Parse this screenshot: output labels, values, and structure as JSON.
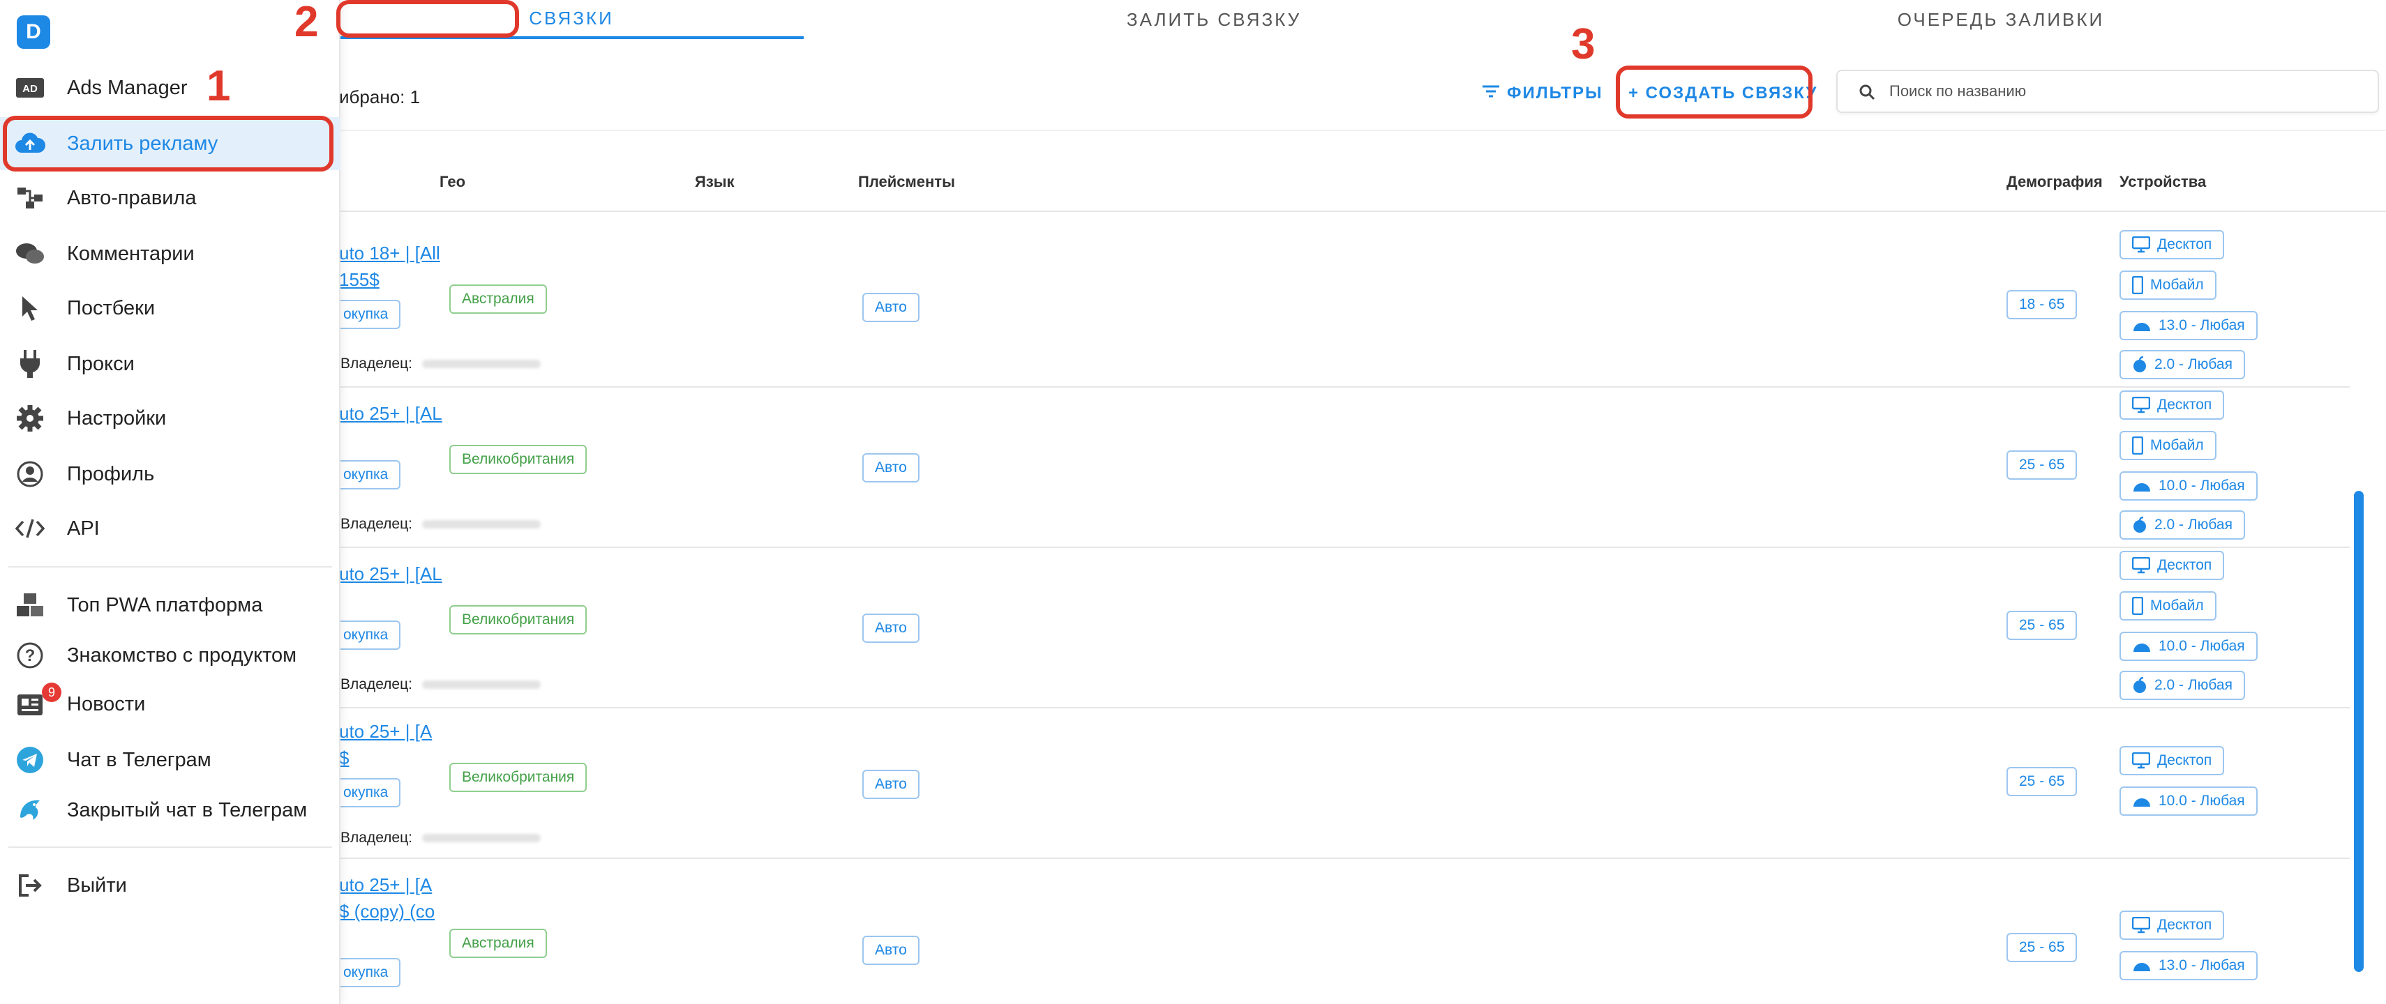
{
  "sidebar": {
    "logo": "D",
    "items": [
      {
        "label": "Ads Manager",
        "icon": "ad-icon"
      },
      {
        "label": "Залить рекламу",
        "icon": "cloud-upload-icon"
      },
      {
        "label": "Авто-правила",
        "icon": "rules-icon"
      },
      {
        "label": "Комментарии",
        "icon": "comments-icon"
      },
      {
        "label": "Постбеки",
        "icon": "cursor-icon"
      },
      {
        "label": "Прокси",
        "icon": "plug-icon"
      },
      {
        "label": "Настройки",
        "icon": "gear-icon"
      },
      {
        "label": "Профиль",
        "icon": "profile-icon"
      },
      {
        "label": "API",
        "icon": "code-icon"
      },
      {
        "label": "Топ PWA платформа",
        "icon": "boxes-icon"
      },
      {
        "label": "Знакомство с продуктом",
        "icon": "help-icon"
      },
      {
        "label": "Новости",
        "icon": "news-icon",
        "badge": "9"
      },
      {
        "label": "Чат в Телеграм",
        "icon": "telegram-icon"
      },
      {
        "label": "Закрытый чат в Телеграм",
        "icon": "dolphin-icon"
      },
      {
        "label": "Выйти",
        "icon": "logout-icon"
      }
    ]
  },
  "annotations": [
    "1",
    "2",
    "3"
  ],
  "tabs": [
    {
      "label": "СВЯЗКИ",
      "active": true
    },
    {
      "label": "ЗАЛИТЬ СВЯЗКУ",
      "active": false
    },
    {
      "label": "ОЧЕРЕДЬ ЗАЛИВКИ",
      "active": false
    }
  ],
  "toolbar": {
    "selected": "ибрано: 1",
    "filters_label": "ФИЛЬТРЫ",
    "create_label": "+ СОЗДАТЬ СВЯЗКУ",
    "search_placeholder": "Поиск по названию"
  },
  "table": {
    "headers": {
      "geo": "Гео",
      "lang": "Язык",
      "placements": "Плейсменты",
      "demo": "Демография",
      "devices": "Устройства"
    },
    "owner_label": "Владелец:",
    "rows": [
      {
        "name_line1": "uto 18+ | [All",
        "name_line2": "155$",
        "objective": "окупка",
        "geo": "Австралия",
        "placement": "Авто",
        "demo": "18 - 65",
        "devices": [
          {
            "icon": "desktop-icon",
            "label": "Десктоп"
          },
          {
            "icon": "mobile-icon",
            "label": "Мобайл"
          },
          {
            "icon": "android-icon",
            "label": "13.0 - Любая"
          },
          {
            "icon": "apple-icon",
            "label": "2.0 - Любая"
          }
        ]
      },
      {
        "name_line1": "uto 25+ | [AL",
        "name_line2": "",
        "objective": "окупка",
        "geo": "Великобритания",
        "placement": "Авто",
        "demo": "25 - 65",
        "devices": [
          {
            "icon": "desktop-icon",
            "label": "Десктоп"
          },
          {
            "icon": "mobile-icon",
            "label": "Мобайл"
          },
          {
            "icon": "android-icon",
            "label": "10.0 - Любая"
          },
          {
            "icon": "apple-icon",
            "label": "2.0 - Любая"
          }
        ]
      },
      {
        "name_line1": "uto 25+ | [AL",
        "name_line2": "",
        "objective": "окупка",
        "geo": "Великобритания",
        "placement": "Авто",
        "demo": "25 - 65",
        "devices": [
          {
            "icon": "desktop-icon",
            "label": "Десктоп"
          },
          {
            "icon": "mobile-icon",
            "label": "Мобайл"
          },
          {
            "icon": "android-icon",
            "label": "10.0 - Любая"
          },
          {
            "icon": "apple-icon",
            "label": "2.0 - Любая"
          }
        ]
      },
      {
        "name_line1": "uto 25+ | [A",
        "name_line2": "$",
        "objective": "окупка",
        "geo": "Великобритания",
        "placement": "Авто",
        "demo": "25 - 65",
        "devices": [
          {
            "icon": "desktop-icon",
            "label": "Десктоп"
          },
          {
            "icon": "android-icon",
            "label": "10.0 - Любая"
          }
        ]
      },
      {
        "name_line1": "uto 25+ | [A",
        "name_line2": "$ (copy) (co",
        "objective": "окупка",
        "geo": "Австралия",
        "placement": "Авто",
        "demo": "25 - 65",
        "devices": [
          {
            "icon": "desktop-icon",
            "label": "Десктоп"
          },
          {
            "icon": "android-icon",
            "label": "13.0 - Любая"
          }
        ]
      }
    ]
  },
  "colors": {
    "accent": "#1e88e5",
    "annotation": "#e0392b",
    "green": "#43a047"
  }
}
